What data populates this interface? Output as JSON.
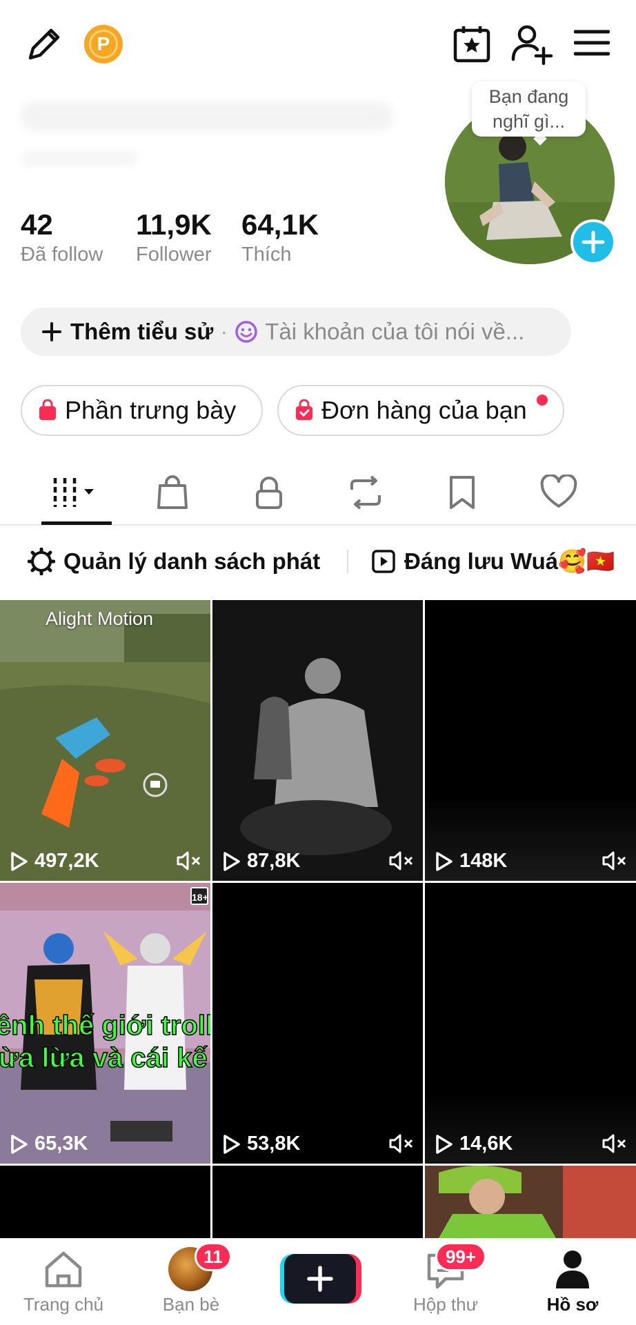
{
  "top_bar": {
    "coin_letter": "P"
  },
  "profile": {
    "note_bubble": "Bạn đang nghĩ gì...",
    "stats": [
      {
        "value": "42",
        "label": "Đã follow"
      },
      {
        "value": "11,9K",
        "label": "Follower"
      },
      {
        "value": "64,1K",
        "label": "Thích"
      }
    ]
  },
  "bio": {
    "add_label": "Thêm tiểu sử",
    "separator": "·",
    "placeholder": "Tài khoản của tôi nói về..."
  },
  "chips": [
    {
      "label": "Phần trưng bày"
    },
    {
      "label": "Đơn hàng của bạn"
    }
  ],
  "tabs": [
    {
      "icon": "grid-icon",
      "active": true
    },
    {
      "icon": "shopping-bag-icon"
    },
    {
      "icon": "lock-icon"
    },
    {
      "icon": "repost-icon"
    },
    {
      "icon": "bookmark-icon"
    },
    {
      "icon": "heart-icon"
    }
  ],
  "playlists": {
    "manage_label": "Quản lý danh sách phát",
    "playlist_name": "Đáng lưu Wuá🥰🇻🇳"
  },
  "videos": [
    {
      "views": "497,2K",
      "overlay_text": "Alight Motion",
      "muted": true
    },
    {
      "views": "87,8K",
      "muted": true
    },
    {
      "views": "148K",
      "muted": true
    },
    {
      "views": "65,3K",
      "overlay_text_1": "ênh thế giới troll l",
      "overlay_text_2": "ừa lừa và cái kế",
      "rating": "18+",
      "muted": false
    },
    {
      "views": "53,8K",
      "muted": true
    },
    {
      "views": "14,6K",
      "muted": true
    },
    {
      "views": ""
    },
    {
      "views": ""
    },
    {
      "views": ""
    }
  ],
  "bottom_nav": [
    {
      "label": "Trang chủ",
      "icon": "home-icon"
    },
    {
      "label": "Bạn bè",
      "icon": "friends-avatar",
      "badge": "11"
    },
    {
      "label": "",
      "icon": "create-plus-icon"
    },
    {
      "label": "Hộp thư",
      "icon": "inbox-icon",
      "badge": "99+"
    },
    {
      "label": "Hồ sơ",
      "icon": "profile-icon",
      "active": true
    }
  ],
  "colors": {
    "accent_red": "#fe2c55",
    "accent_cyan": "#20bde6",
    "coin_orange": "#f5a623",
    "text_gray": "#8a8a8a"
  }
}
